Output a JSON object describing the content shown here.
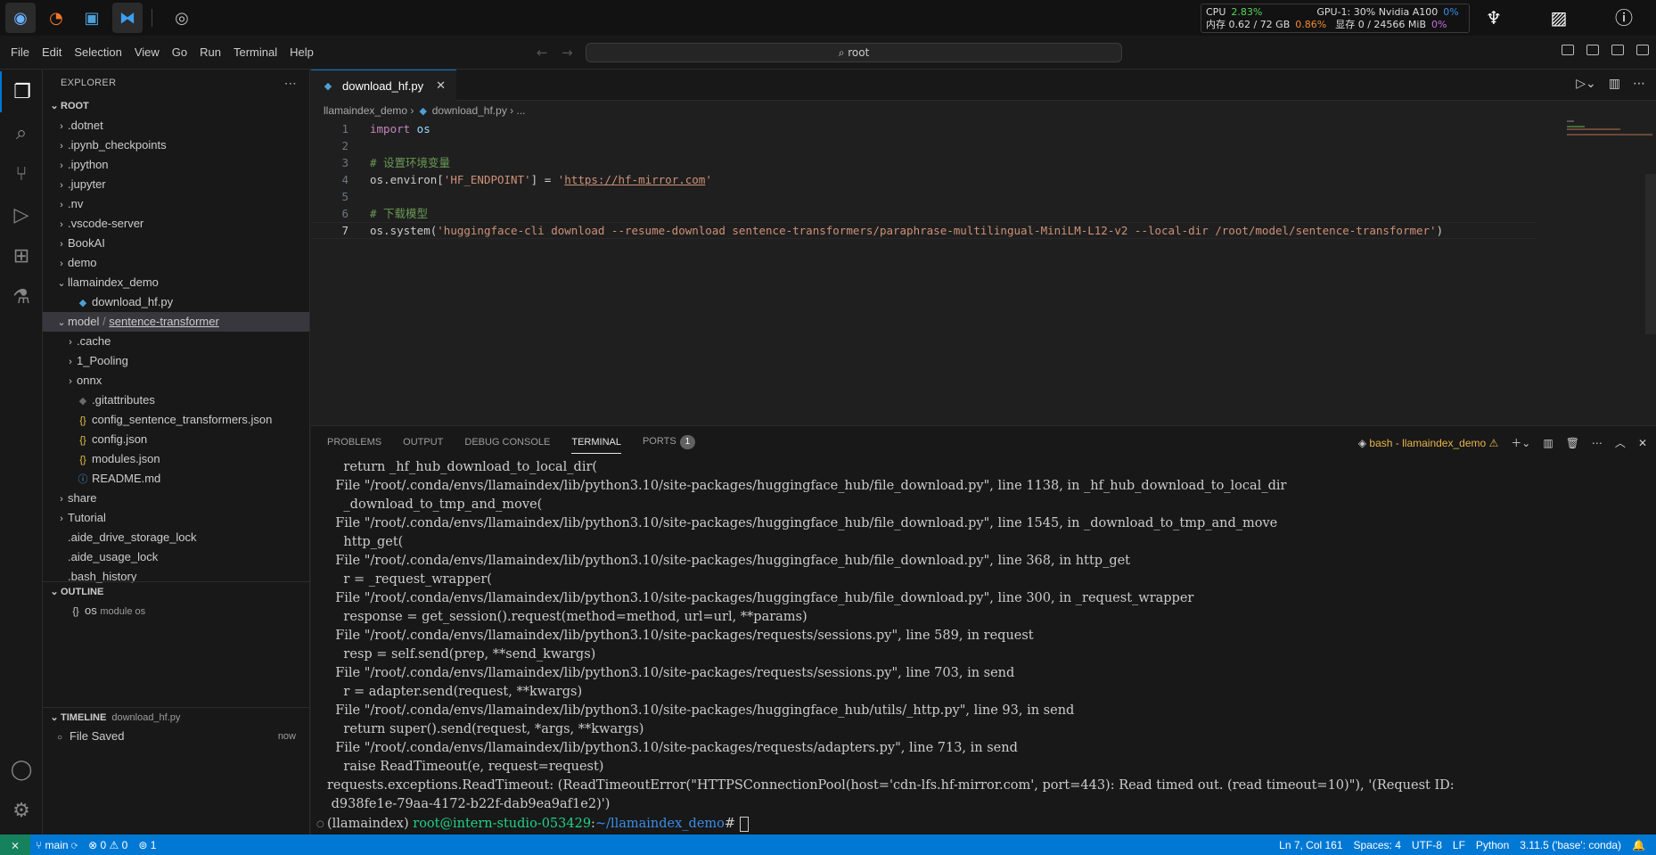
{
  "topbar": {
    "sys": {
      "cpu_label": "CPU",
      "cpu_value": "2.83%",
      "gpu_label": "GPU-1: 30% Nvidia A100",
      "gpu_value": "0%",
      "mem_label": "内存 0.62 / 72 GB",
      "mem_value": "0.86%",
      "vram_label": "显存 0 / 24566 MiB",
      "vram_value": "0%"
    }
  },
  "menu": [
    "File",
    "Edit",
    "Selection",
    "View",
    "Go",
    "Run",
    "Terminal",
    "Help"
  ],
  "command_center": "root",
  "explorer": {
    "header": "EXPLORER",
    "root": "ROOT",
    "items": [
      {
        "label": ".dotnet",
        "type": "folder",
        "depth": 1
      },
      {
        "label": ".ipynb_checkpoints",
        "type": "folder",
        "depth": 1
      },
      {
        "label": ".ipython",
        "type": "folder",
        "depth": 1
      },
      {
        "label": ".jupyter",
        "type": "folder",
        "depth": 1
      },
      {
        "label": ".nv",
        "type": "folder",
        "depth": 1
      },
      {
        "label": ".vscode-server",
        "type": "folder",
        "depth": 1
      },
      {
        "label": "BookAI",
        "type": "folder",
        "depth": 1
      },
      {
        "label": "demo",
        "type": "folder",
        "depth": 1
      },
      {
        "label": "llamaindex_demo",
        "type": "folder-open",
        "depth": 1
      },
      {
        "label": "download_hf.py",
        "type": "py",
        "depth": 2
      },
      {
        "label": "model",
        "label2": "sentence-transformer",
        "type": "folder-open",
        "depth": 1,
        "selected": true
      },
      {
        "label": ".cache",
        "type": "folder",
        "depth": 2
      },
      {
        "label": "1_Pooling",
        "type": "folder",
        "depth": 2
      },
      {
        "label": "onnx",
        "type": "folder",
        "depth": 2
      },
      {
        "label": ".gitattributes",
        "type": "git",
        "depth": 2
      },
      {
        "label": "config_sentence_transformers.json",
        "type": "json",
        "depth": 2
      },
      {
        "label": "config.json",
        "type": "json",
        "depth": 2
      },
      {
        "label": "modules.json",
        "type": "json",
        "depth": 2
      },
      {
        "label": "README.md",
        "type": "info",
        "depth": 2
      },
      {
        "label": "share",
        "type": "folder",
        "depth": 1
      },
      {
        "label": "Tutorial",
        "type": "folder",
        "depth": 1
      },
      {
        "label": ".aide_drive_storage_lock",
        "type": "file",
        "depth": 1
      },
      {
        "label": ".aide_usage_lock",
        "type": "file",
        "depth": 1
      },
      {
        "label": ".bash_history",
        "type": "file",
        "depth": 1
      }
    ]
  },
  "outline": {
    "title": "OUTLINE",
    "item": "os",
    "item_detail": "module os"
  },
  "timeline": {
    "title": "TIMELINE",
    "file": "download_hf.py",
    "entry": "File Saved",
    "time": "now"
  },
  "editor": {
    "tab": "download_hf.py",
    "breadcrumb": [
      "llamaindex_demo",
      "download_hf.py",
      "..."
    ],
    "lines": [
      "1",
      "2",
      "3",
      "4",
      "5",
      "6",
      "7"
    ],
    "code": {
      "l1_kw": "import",
      "l1_mod": " os",
      "l3": "# 设置环境变量",
      "l4_a": "os.environ[",
      "l4_key": "'HF_ENDPOINT'",
      "l4_b": "] = ",
      "l4_q1": "'",
      "l4_url": "https://hf-mirror.com",
      "l4_q2": "'",
      "l6": "# 下载模型",
      "l7_a": "os.system(",
      "l7_str": "'huggingface-cli download --resume-download sentence-transformers/paraphrase-multilingual-MiniLM-L12-v2 --local-dir /root/model/sentence-transformer'",
      "l7_b": ")"
    }
  },
  "panel": {
    "tabs": [
      "PROBLEMS",
      "OUTPUT",
      "DEBUG CONSOLE",
      "TERMINAL",
      "PORTS"
    ],
    "ports_badge": "1",
    "terminal_name": "bash - llamaindex_demo",
    "lines": [
      "    return _hf_hub_download_to_local_dir(",
      "  File \"/root/.conda/envs/llamaindex/lib/python3.10/site-packages/huggingface_hub/file_download.py\", line 1138, in _hf_hub_download_to_local_dir",
      "    _download_to_tmp_and_move(",
      "  File \"/root/.conda/envs/llamaindex/lib/python3.10/site-packages/huggingface_hub/file_download.py\", line 1545, in _download_to_tmp_and_move",
      "    http_get(",
      "  File \"/root/.conda/envs/llamaindex/lib/python3.10/site-packages/huggingface_hub/file_download.py\", line 368, in http_get",
      "    r = _request_wrapper(",
      "  File \"/root/.conda/envs/llamaindex/lib/python3.10/site-packages/huggingface_hub/file_download.py\", line 300, in _request_wrapper",
      "    response = get_session().request(method=method, url=url, **params)",
      "  File \"/root/.conda/envs/llamaindex/lib/python3.10/site-packages/requests/sessions.py\", line 589, in request",
      "    resp = self.send(prep, **send_kwargs)",
      "  File \"/root/.conda/envs/llamaindex/lib/python3.10/site-packages/requests/sessions.py\", line 703, in send",
      "    r = adapter.send(request, **kwargs)",
      "  File \"/root/.conda/envs/llamaindex/lib/python3.10/site-packages/huggingface_hub/utils/_http.py\", line 93, in send",
      "    return super().send(request, *args, **kwargs)",
      "  File \"/root/.conda/envs/llamaindex/lib/python3.10/site-packages/requests/adapters.py\", line 713, in send",
      "    raise ReadTimeout(e, request=request)",
      "requests.exceptions.ReadTimeout: (ReadTimeoutError(\"HTTPSConnectionPool(host='cdn-lfs.hf-mirror.com', port=443): Read timed out. (read timeout=10)\"), '(Request ID:",
      " d938fe1e-79aa-4172-b22f-dab9ea9af1e2)')"
    ],
    "prompt_env": "(llamaindex) ",
    "prompt_user": "root@intern-studio-053429",
    "prompt_colon": ":",
    "prompt_path": "~/llamaindex_demo",
    "prompt_end": "# "
  },
  "status": {
    "branch": "main",
    "errors": "0",
    "warnings": "0",
    "ports": "1",
    "position": "Ln 7, Col 161",
    "spaces": "Spaces: 4",
    "encoding": "UTF-8",
    "eol": "LF",
    "language": "Python",
    "interpreter": "3.11.5 ('base': conda)"
  }
}
